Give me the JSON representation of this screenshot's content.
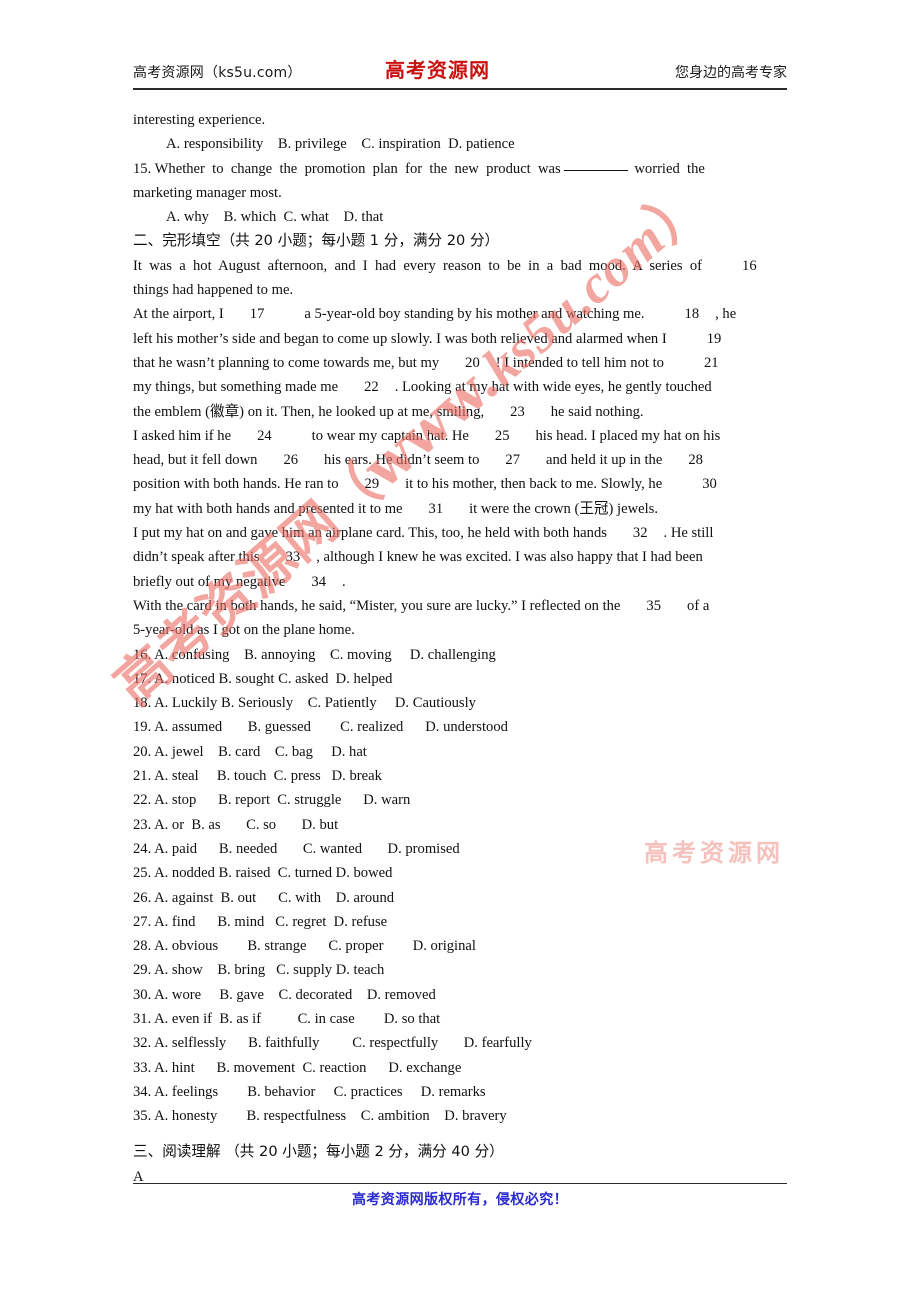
{
  "header": {
    "left": "高考资源网（ks5u.com）",
    "logo": "高考资源网",
    "right": "您身边的高考专家"
  },
  "footer": {
    "text": "高考资源网版权所有，侵权必究！"
  },
  "watermarks": {
    "diagonal_cn": "高考资源网（www.",
    "diagonal_latin": "ks5u.com",
    "diagonal_tail": "）",
    "faint": "高考资源网",
    "diagonal_color": "#eb6e64",
    "faint_color": "#f2afaa",
    "logo_color": "#c9110f",
    "footer_color": "#2a2ad0"
  },
  "question14": {
    "stem_tail": "interesting experience.",
    "options": "A. responsibility    B. privilege    C. inspiration  D. patience"
  },
  "question15": {
    "number": "15.",
    "stem_a": "Whether  to  change  the  promotion  plan  for  the  new  product  was",
    "stem_b": "worried  the",
    "stem_c": "marketing manager most.",
    "options": "A. why    B. which  C. what    D. that"
  },
  "section2": {
    "heading": "二、完形填空（共 20 小题；每小题 1 分，满分 20 分）",
    "passage": [
      {
        "text": "It  was  a  hot  August  afternoon,  and  I  had  every  reason  to  be  in  a  bad  mood.  A  series  of",
        "num": "16"
      },
      {
        "text": "things had happened to me.",
        "num": ""
      },
      {
        "text_pre": "At the airport, I",
        "n1": "17",
        "text_mid": "a 5-year-old boy standing by his mother and watching me.",
        "n2": "18",
        "text_post": ", he"
      },
      {
        "text": "left his mother’s side and began to come up slowly. I was both relieved and alarmed when I",
        "num": "19"
      },
      {
        "text_pre": "that he wasn’t planning to come towards me, but my",
        "n1": "20",
        "text_mid": "! I intended to tell him not to",
        "n2": "21",
        "text_post": ""
      },
      {
        "text_pre": "my things, but something made me",
        "n1": "22",
        "text_mid": ". Looking at my hat with wide eyes, he gently touched",
        "n2": "",
        "text_post": ""
      },
      {
        "text_pre": "the emblem (徽章) on it. Then, he looked up at me, smiling,",
        "n1": "23",
        "text_mid": "he said nothing.",
        "n2": "",
        "text_post": ""
      },
      {
        "text_pre": "I asked him if he",
        "n1": "24",
        "text_mid": "to wear my captain hat. He",
        "n2": "25",
        "text_post": "his head. I placed my hat on his"
      },
      {
        "text_pre": "head, but it fell down",
        "n1": "26",
        "text_mid": "his ears. He didn’t seem to",
        "n2": "27",
        "text_post": "and held it up in the",
        "n3": "28"
      },
      {
        "text_pre": "position with both hands. He ran to",
        "n1": "29",
        "text_mid": "it to his mother, then back to me. Slowly, he",
        "n2": "30",
        "text_post": ""
      },
      {
        "text_pre": "my hat with both hands and presented it to me",
        "n1": "31",
        "text_mid": "it were the crown (王冠) jewels.",
        "n2": "",
        "text_post": ""
      },
      {
        "text_pre": "I put my hat on and gave him an airplane card. This, too, he held with both hands",
        "n1": "32",
        "text_mid": ". He still",
        "n2": "",
        "text_post": ""
      },
      {
        "text_pre": "didn’t speak after this",
        "n1": "33",
        "text_mid": ", although I knew he was excited. I was also happy that I had been",
        "n2": "",
        "text_post": ""
      },
      {
        "text_pre": "briefly out of my negative",
        "n1": "34",
        "text_mid": ".",
        "n2": "",
        "text_post": ""
      },
      {
        "text_pre": "With the card in both hands, he said, “Mister, you sure are lucky.” I reflected on the",
        "n1": "35",
        "text_mid": "of a",
        "n2": "",
        "text_post": ""
      },
      {
        "text": "5-year-old as I got on the plane home.",
        "num": ""
      }
    ],
    "choices": [
      "16. A. confusing    B. annoying    C. moving     D. challenging",
      "17. A. noticed B. sought C. asked  D. helped",
      "18. A. Luckily B. Seriously    C. Patiently     D. Cautiously",
      "19. A. assumed       B. guessed        C. realized      D. understood",
      "20. A. jewel    B. card    C. bag     D. hat",
      "21. A. steal     B. touch  C. press   D. break",
      "22. A. stop      B. report  C. struggle      D. warn",
      "23. A. or  B. as       C. so       D. but",
      "24. A. paid      B. needed       C. wanted       D. promised",
      "25. A. nodded B. raised  C. turned D. bowed",
      "26. A. against  B. out      C. with    D. around",
      "27. A. find      B. mind   C. regret  D. refuse",
      "28. A. obvious        B. strange      C. proper        D. original",
      "29. A. show    B. bring   C. supply D. teach",
      "30. A. wore     B. gave    C. decorated    D. removed",
      "31. A. even if  B. as if          C. in case        D. so that",
      "32. A. selflessly      B. faithfully         C. respectfully       D. fearfully",
      "33. A. hint      B. movement  C. reaction      D. exchange",
      "34. A. feelings        B. behavior     C. practices     D. remarks",
      "35. A. honesty        B. respectfulness    C. ambition    D. bravery"
    ]
  },
  "section3": {
    "heading": "三、阅读理解 （共 20 小题；每小题 2 分，满分 40 分）",
    "part_label": "A"
  }
}
